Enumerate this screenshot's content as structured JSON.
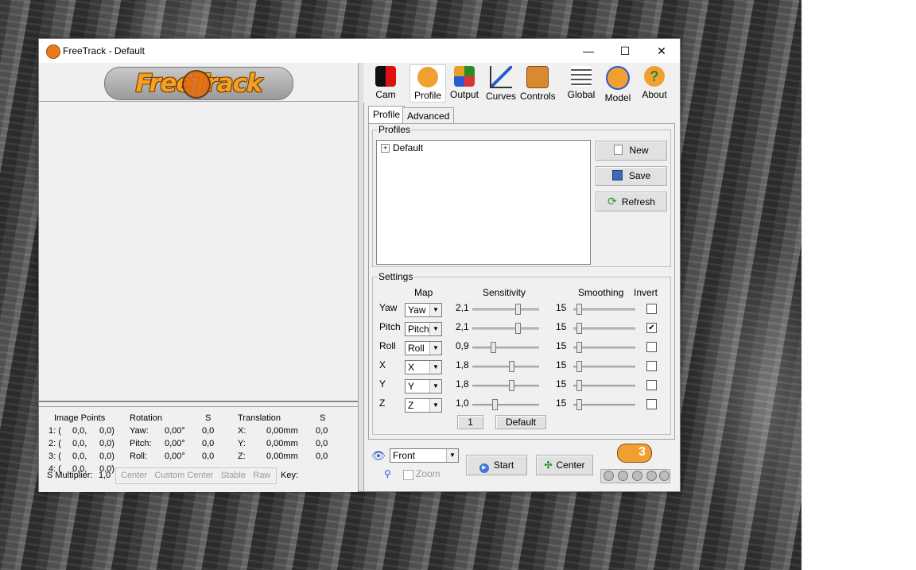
{
  "window": {
    "title": "FreeTrack - Default",
    "minimize": "—",
    "maximize": "☐",
    "close": "✕"
  },
  "logo": {
    "text": "FreeTrack"
  },
  "toolbar": [
    "Cam",
    "Profile",
    "Output",
    "Curves",
    "Controls",
    "Global",
    "Model",
    "About"
  ],
  "tabs": {
    "profile": "Profile",
    "advanced": "Advanced"
  },
  "profiles": {
    "label": "Profiles",
    "tree_item": "Default",
    "expander": "+",
    "new": "New",
    "save": "Save",
    "refresh": "Refresh"
  },
  "settings": {
    "label": "Settings",
    "headers": {
      "map": "Map",
      "sensitivity": "Sensitivity",
      "smoothing": "Smoothing",
      "invert": "Invert"
    },
    "rows": [
      {
        "axis": "Yaw",
        "map": "Yaw",
        "sens": "2,1",
        "smooth": "15",
        "invert": false,
        "sens_level": 0.7,
        "smooth_level": 0.05
      },
      {
        "axis": "Pitch",
        "map": "Pitch",
        "sens": "2,1",
        "smooth": "15",
        "invert": true,
        "sens_level": 0.7,
        "smooth_level": 0.05
      },
      {
        "axis": "Roll",
        "map": "Roll",
        "sens": "0,9",
        "smooth": "15",
        "invert": false,
        "sens_level": 0.3,
        "smooth_level": 0.05
      },
      {
        "axis": "X",
        "map": "X",
        "sens": "1,8",
        "smooth": "15",
        "invert": false,
        "sens_level": 0.6,
        "smooth_level": 0.05
      },
      {
        "axis": "Y",
        "map": "Y",
        "sens": "1,8",
        "smooth": "15",
        "invert": false,
        "sens_level": 0.6,
        "smooth_level": 0.05
      },
      {
        "axis": "Z",
        "map": "Z",
        "sens": "1,0",
        "smooth": "15",
        "invert": false,
        "sens_level": 0.33,
        "smooth_level": 0.05
      }
    ],
    "page_button": "1",
    "default_button": "Default"
  },
  "info": {
    "headers": {
      "image_points": "Image Points",
      "rotation": "Rotation",
      "s1": "S",
      "translation": "Translation",
      "s2": "S"
    },
    "points": [
      [
        "1: (",
        "0,0,",
        "0,0)"
      ],
      [
        "2: (",
        "0,0,",
        "0,0)"
      ],
      [
        "3: (",
        "0,0,",
        "0,0)"
      ],
      [
        "4: (",
        "0,0,",
        "0,0)"
      ]
    ],
    "rotation": [
      {
        "label": "Yaw:",
        "value": "0,00°",
        "s": "0,0"
      },
      {
        "label": "Pitch:",
        "value": "0,00°",
        "s": "0,0"
      },
      {
        "label": "Roll:",
        "value": "0,00°",
        "s": "0,0"
      }
    ],
    "translation": [
      {
        "label": "X:",
        "value": "0,00mm",
        "s": "0,0"
      },
      {
        "label": "Y:",
        "value": "0,00mm",
        "s": "0,0"
      },
      {
        "label": "Z:",
        "value": "0,00mm",
        "s": "0,0"
      }
    ],
    "s_multiplier_label": "S Multiplier:",
    "s_multiplier_value": "1,0",
    "status": [
      "Center",
      "Custom Center",
      "Stable",
      "Raw"
    ],
    "key_label": "Key:"
  },
  "bottom": {
    "view": "Front",
    "zoom": "Zoom",
    "start": "Start",
    "center": "Center",
    "badge": "3"
  },
  "colors": {
    "accent": "#f7a020",
    "window_bg": "#f0f0f0"
  }
}
